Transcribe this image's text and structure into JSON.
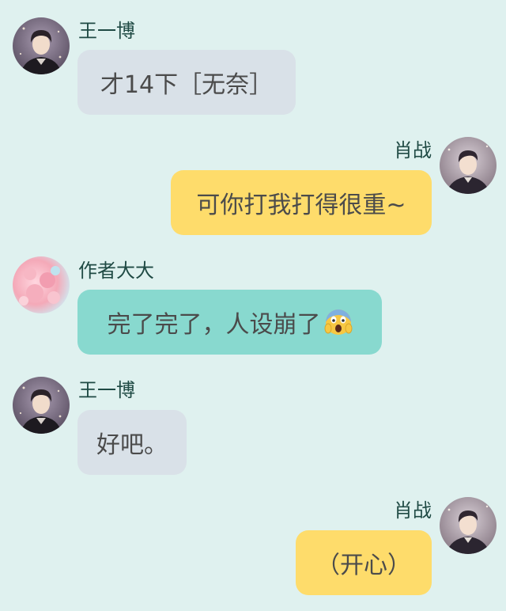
{
  "messages": [
    {
      "side": "left",
      "sender": "王一博",
      "avatar_icon": "boy-portrait-dark-avatar",
      "text": "才14下［无奈］",
      "bubble_color": "#d9e1e8"
    },
    {
      "side": "right",
      "sender": "肖战",
      "avatar_icon": "man-portrait-avatar",
      "text": "可你打我打得很重~",
      "bubble_color": "#fedc6b"
    },
    {
      "side": "left",
      "sender": "作者大大",
      "avatar_icon": "cherry-blossom-avatar",
      "text": "完了完了，人设崩了",
      "emoji": "screaming-face-emoji",
      "bubble_color": "#88d9cf"
    },
    {
      "side": "left",
      "sender": "王一博",
      "avatar_icon": "boy-portrait-dark-avatar",
      "text": "好吧。",
      "bubble_color": "#d9e1e8"
    },
    {
      "side": "right",
      "sender": "肖战",
      "avatar_icon": "man-portrait-avatar",
      "text": "（开心）",
      "bubble_color": "#fedc6b"
    }
  ],
  "colors": {
    "background": "#dff1ef",
    "name_text": "#1f4a44",
    "bubble_text": "#4b4b4b"
  }
}
